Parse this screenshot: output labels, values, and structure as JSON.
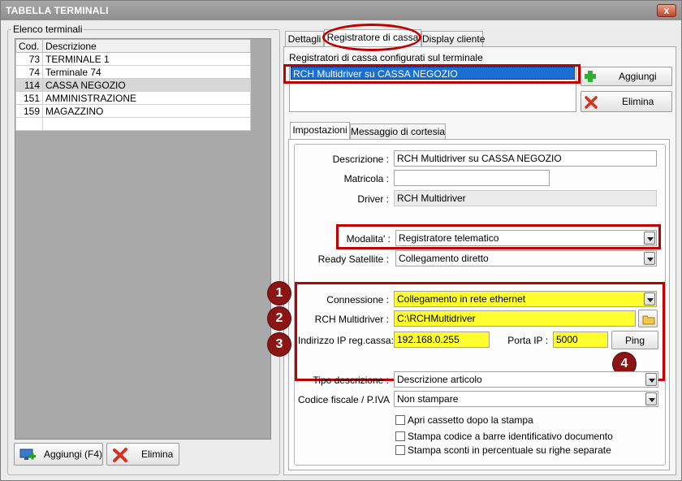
{
  "window": {
    "title": "TABELLA TERMINALI",
    "close_label": "x"
  },
  "left": {
    "group_label": "Elenco terminali",
    "columns": [
      "Cod.",
      "Descrizione"
    ],
    "rows": [
      {
        "cod": "73",
        "descrizione": "TERMINALE 1"
      },
      {
        "cod": "74",
        "descrizione": "Terminale 74"
      },
      {
        "cod": "114",
        "descrizione": "CASSA NEGOZIO"
      },
      {
        "cod": "151",
        "descrizione": "AMMINISTRAZIONE"
      },
      {
        "cod": "159",
        "descrizione": "MAGAZZINO"
      }
    ],
    "selected_row": 2,
    "add_button": "Aggiungi (F4)",
    "delete_button": "Elimina"
  },
  "tabs": {
    "items": [
      "Dettagli",
      "Registratore di cassa",
      "Display cliente"
    ],
    "active": 1
  },
  "registers": {
    "caption": "Registratori di cassa configurati sul terminale",
    "items": [
      "RCH Multidriver su CASSA NEGOZIO"
    ],
    "add_button": "Aggiungi",
    "delete_button": "Elimina"
  },
  "subtabs": {
    "items": [
      "Impostazioni",
      "Messaggio di cortesia"
    ],
    "active": 0
  },
  "form": {
    "descrizione_label": "Descrizione :",
    "descrizione_value": "RCH Multidriver su CASSA NEGOZIO",
    "matricola_label": "Matricola :",
    "matricola_value": "",
    "driver_label": "Driver :",
    "driver_value": "RCH Multidriver",
    "modalita_label": "Modalita' :",
    "modalita_value": "Registratore telematico",
    "ready_label": "Ready Satellite :",
    "ready_value": "Collegamento diretto",
    "connessione_label": "Connessione :",
    "connessione_value": "Collegamento in rete ethernet",
    "rch_label": "RCH Multidriver :",
    "rch_value": "C:\\RCHMultidriver",
    "ip_label": "Indirizzo IP reg.cassa:",
    "ip_value": "192.168.0.255",
    "porta_label": "Porta IP :",
    "porta_value": "5000",
    "ping_button": "Ping",
    "tipo_label": "Tipo descrizione :",
    "tipo_value": "Descrizione articolo",
    "cf_label": "Codice fiscale / P.IVA",
    "cf_value": "Non stampare",
    "check1": "Apri cassetto dopo la stampa",
    "check2": "Stampa codice a barre identificativo documento",
    "check3": "Stampa sconti in percentuale su righe separate"
  },
  "badges": [
    "1",
    "2",
    "3",
    "4"
  ],
  "colors": {
    "highlight": "#c00000",
    "badge": "#8b1414",
    "required_field": "#ffff30",
    "selection": "#1c6fd2"
  },
  "icons": {
    "add": "plus-icon",
    "delete": "x-icon",
    "folder": "folder-icon",
    "add_terminal": "monitor-add-icon"
  }
}
